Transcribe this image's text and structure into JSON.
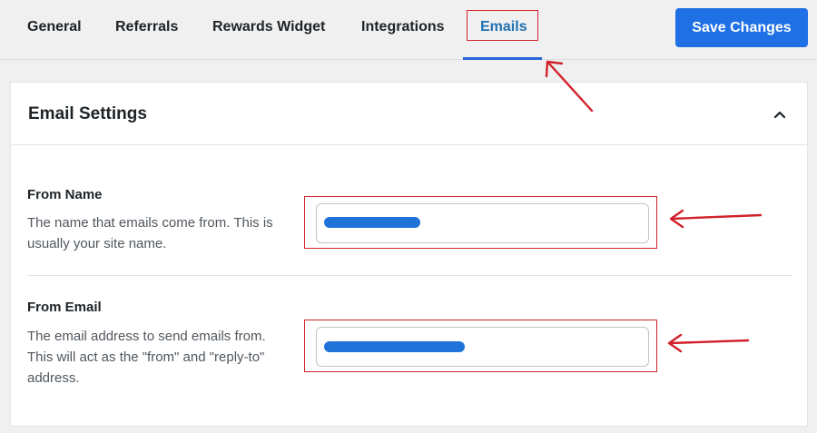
{
  "tabs": [
    {
      "label": "General"
    },
    {
      "label": "Referrals"
    },
    {
      "label": "Rewards Widget"
    },
    {
      "label": "Integrations"
    },
    {
      "label": "Emails",
      "active": true
    }
  ],
  "toolbar": {
    "save_label": "Save Changes"
  },
  "panel": {
    "title": "Email Settings",
    "collapse_icon": "chevron-up-icon"
  },
  "fields": {
    "from_name": {
      "label": "From Name",
      "description": "The name that emails come from. This is usually your site name.",
      "value": ""
    },
    "from_email": {
      "label": "From Email",
      "description": "The email address to send emails from. This will act as the \"from\" and \"reply-to\" address.",
      "value": ""
    }
  },
  "colors": {
    "accent": "#1f6fe5",
    "active_tab": "#2271b1",
    "annotation": "#d1222b",
    "redaction": "#1f73d8"
  }
}
